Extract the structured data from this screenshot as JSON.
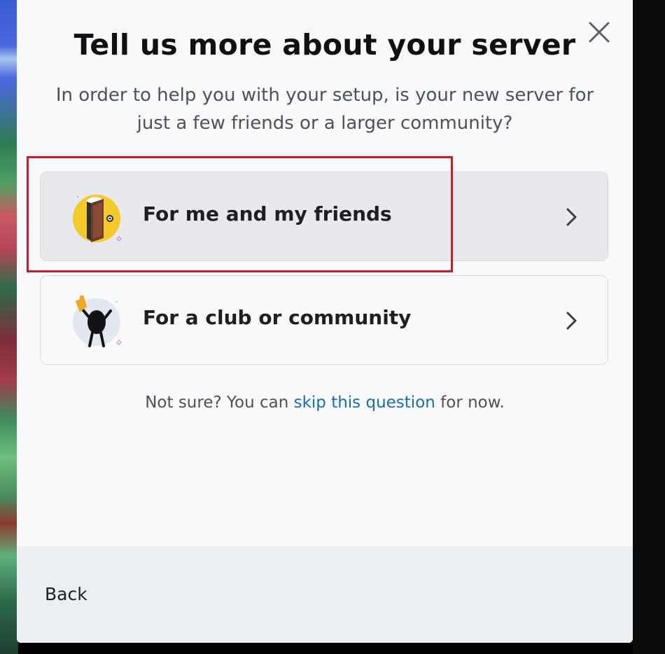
{
  "modal": {
    "title": "Tell us more about your server",
    "subtitle": "In order to help you with your setup, is your new server for just a few friends or a larger community?",
    "options": [
      {
        "label": "For me and my friends",
        "icon": "door-icon"
      },
      {
        "label": "For a club or community",
        "icon": "cheering-character-icon"
      }
    ],
    "skip": {
      "prefix": "Not sure? You can ",
      "link": "skip this question",
      "suffix": " for now."
    },
    "footer": {
      "back_label": "Back"
    }
  },
  "colors": {
    "highlight": "#cc1a2b",
    "link": "#1a6bb5",
    "icon_yellow": "#f4c92a"
  }
}
